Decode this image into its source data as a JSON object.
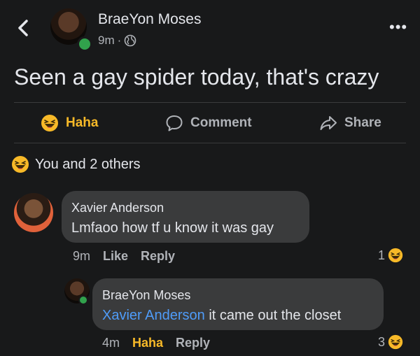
{
  "header": {
    "author": "BraeYon Moses",
    "time": "9m",
    "separator": "·"
  },
  "post": {
    "text": "Seen a gay spider today, that's crazy"
  },
  "actions": {
    "haha": "Haha",
    "comment": "Comment",
    "share": "Share"
  },
  "reactions": {
    "summary": "You and 2 others"
  },
  "comments": [
    {
      "name": "Xavier Anderson",
      "text": "Lmfaoo how tf u know it was gay",
      "time": "9m",
      "like": "Like",
      "reply": "Reply",
      "reaction_count": "1"
    },
    {
      "name": "BraeYon Moses",
      "mention": "Xavier Anderson",
      "text": " it came out the closet",
      "time": "4m",
      "like": "Haha",
      "reply": "Reply",
      "reaction_count": "3"
    }
  ],
  "colors": {
    "background": "#18191a",
    "bubble": "#3a3b3c",
    "text": "#e4e6eb",
    "muted": "#b0b3b8",
    "haha": "#f7b928",
    "link": "#4f9cf9",
    "online": "#31a24c"
  },
  "icons": [
    "back-arrow-icon",
    "globe-icon",
    "more-icon",
    "haha-emoji-icon",
    "comment-icon",
    "share-icon"
  ]
}
